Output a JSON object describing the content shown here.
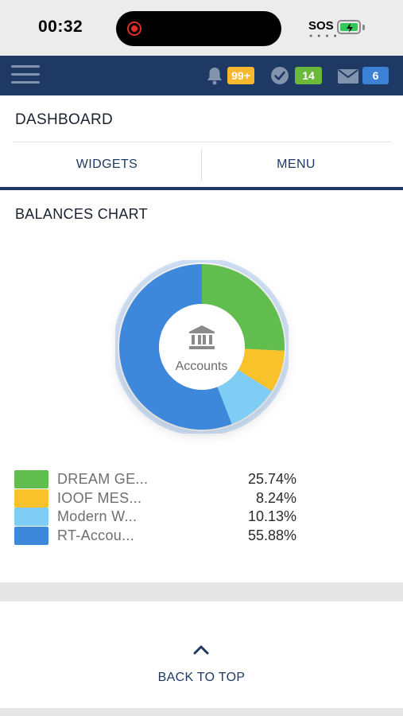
{
  "status_bar": {
    "time": "00:32",
    "sos": "SOS"
  },
  "header": {
    "notifications_badge": "99+",
    "tasks_badge": "14",
    "messages_badge": "6"
  },
  "dashboard": {
    "title": "DASHBOARD",
    "tabs": [
      {
        "label": "WIDGETS"
      },
      {
        "label": "MENU"
      }
    ]
  },
  "balances_chart": {
    "title": "BALANCES CHART",
    "center_label": "Accounts"
  },
  "chart_data": {
    "type": "pie",
    "title": "BALANCES CHART",
    "categories": [
      "DREAM GE...",
      "IOOF MES...",
      "Modern W...",
      "RT-Accou..."
    ],
    "values": [
      25.74,
      8.24,
      10.13,
      55.88
    ],
    "labels": [
      "25.74%",
      "8.24%",
      "10.13%",
      "55.88%"
    ],
    "colors": [
      "#62bd4f",
      "#f9c22a",
      "#7fcdf4",
      "#3e88dc"
    ],
    "legend": "bottom"
  },
  "footer": {
    "back_to_top": "BACK TO TOP"
  },
  "colors": {
    "header_bg": "#1e3a64",
    "accent": "#1e3a64"
  }
}
